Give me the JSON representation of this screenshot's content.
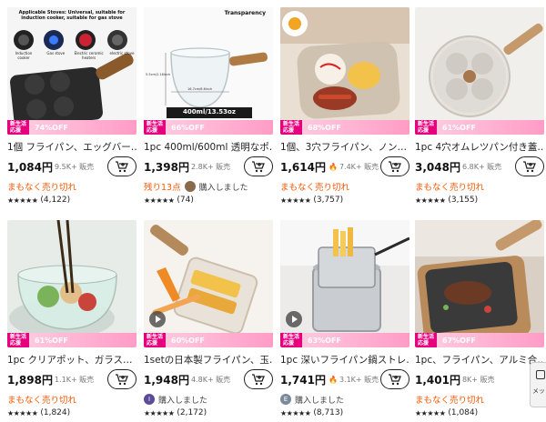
{
  "products": [
    {
      "title": "1個 フライパン、エッグバー…",
      "price": "1,084円",
      "sold": "9.5K+ 販売",
      "hot": false,
      "status": "まもなく売り切れ",
      "buyer": null,
      "rating_count": "(4,122)",
      "discount": "74%OFF",
      "badge": [
        "新生活",
        "応援"
      ],
      "video": false,
      "image_text": {
        "stoves": "Applicable Stoves: Universal, suitable for induction cooker, suitable for gas stove",
        "labels": [
          "Induction cooker",
          "Gas stove",
          "Electric ceramic heaters",
          "electric stove"
        ]
      }
    },
    {
      "title": "1pc 400ml/600ml 透明なポ…",
      "price": "1,398円",
      "sold": "2.8K+ 販売",
      "hot": false,
      "status": "残り13点",
      "buyer": "購入しました",
      "buyer_avatar": "",
      "rating_count": "(74)",
      "discount": "66%OFF",
      "badge": [
        "新生活",
        "応援"
      ],
      "video": false,
      "image_text": {
        "header": "Transparency",
        "dim1": "5.5cm/2.16inch",
        "dim2": "16.7cm/6.6inch",
        "caption": "400ml/13.53oz"
      }
    },
    {
      "title": "1個、3穴フライパン、ノン…",
      "price": "1,614円",
      "sold": "7.4K+ 販売",
      "hot": true,
      "status": "まもなく売り切れ",
      "buyer": null,
      "rating_count": "(3,757)",
      "discount": "68%OFF",
      "badge": [
        "新生活",
        "応援"
      ],
      "video": false
    },
    {
      "title": "1pc 4穴オムレツパン付き蓋…",
      "price": "3,048円",
      "sold": "6.8K+ 販売",
      "hot": false,
      "status": "まもなく売り切れ",
      "buyer": null,
      "rating_count": "(3,155)",
      "discount": "61%OFF",
      "badge": [
        "新生活",
        "応援"
      ],
      "video": false
    },
    {
      "title": "1pc クリアポット、ガラス…",
      "price": "1,898円",
      "sold": "1.1K+ 販売",
      "hot": false,
      "status": "まもなく売り切れ",
      "buyer": null,
      "rating_count": "(1,824)",
      "discount": "61%OFF",
      "badge": [
        "新生活",
        "応援"
      ],
      "video": false
    },
    {
      "title": "1setの日本製フライパン、玉…",
      "price": "1,948円",
      "sold": "4.8K+ 販売",
      "hot": false,
      "status": null,
      "buyer": "購入しました",
      "buyer_avatar": "",
      "rating_count": "(2,172)",
      "discount": "60%OFF",
      "badge": [
        "新生活",
        "応援"
      ],
      "video": true
    },
    {
      "title": "1pc 深いフライパン鍋ストレ…",
      "price": "1,741円",
      "sold": "3.1K+ 販売",
      "hot": true,
      "status": null,
      "buyer": "購入しました",
      "buyer_avatar": "E",
      "rating_count": "(8,713)",
      "discount": "63%OFF",
      "badge": [
        "新生活",
        "応援"
      ],
      "video": true
    },
    {
      "title": "1pc、フライパン、アルミ合…",
      "price": "1,401円",
      "sold": "8K+ 販売",
      "hot": false,
      "status": "まもなく売り切れ",
      "buyer": null,
      "rating_count": "(1,084)",
      "discount": "67%OFF",
      "badge": [
        "新生活",
        "応援"
      ],
      "video": false
    }
  ],
  "stars": "★★★★★",
  "side_tab_label": "メッ",
  "colors": {
    "accent": "#fb5500",
    "promo_badge": "#e6007e",
    "promo_bg": "#ff9cc6"
  }
}
